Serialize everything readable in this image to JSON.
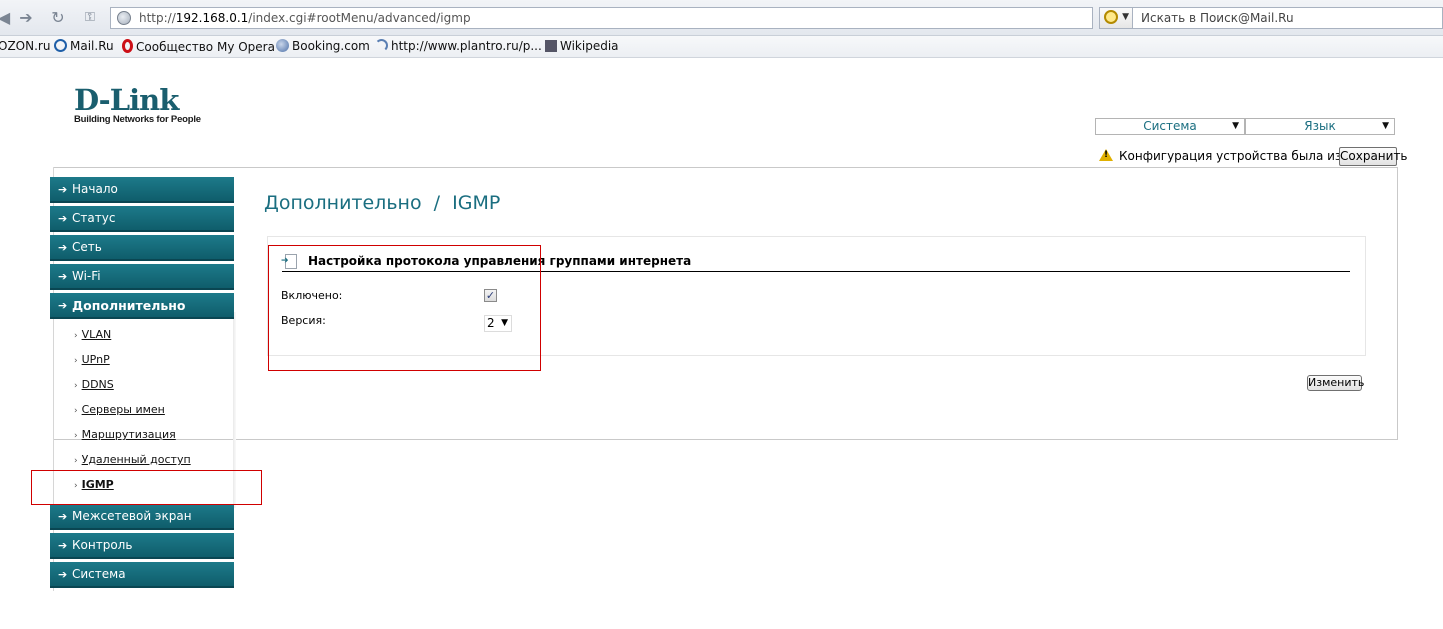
{
  "browser": {
    "url_prefix": "http://",
    "url_host": "192.168.0.1",
    "url_path": "/index.cgi#rootMenu/advanced/igmp",
    "search_placeholder": "Искать в Поиск@Mail.Ru"
  },
  "bookmarks": [
    {
      "label": "OZON.ru",
      "icon": "none"
    },
    {
      "label": "Mail.Ru",
      "icon": "at-icon"
    },
    {
      "label": "Сообщество My Opera",
      "icon": "opera-icon"
    },
    {
      "label": "Booking.com",
      "icon": "globe-icon"
    },
    {
      "label": "http://www.plantro.ru/p...",
      "icon": "rss-icon"
    },
    {
      "label": "Wikipedia",
      "icon": "wikipedia-icon"
    }
  ],
  "header": {
    "logo_main": "D-Link",
    "logo_tagline": "Building Networks for People",
    "system_select": "Система",
    "language_select": "Язык",
    "config_notice": "Конфигурация устройства была изменена",
    "save_label": "Сохранить"
  },
  "sidebar": {
    "items": [
      {
        "label": "Начало"
      },
      {
        "label": "Статус"
      },
      {
        "label": "Сеть"
      },
      {
        "label": "Wi-Fi"
      },
      {
        "label": "Дополнительно"
      },
      {
        "label": "Межсетевой экран"
      },
      {
        "label": "Контроль"
      },
      {
        "label": "Система"
      }
    ],
    "subitems": [
      {
        "label": "VLAN"
      },
      {
        "label": "UPnP"
      },
      {
        "label": "DDNS"
      },
      {
        "label": "Серверы имен"
      },
      {
        "label": "Маршрутизация"
      },
      {
        "label": "Удаленный доступ"
      },
      {
        "label": "IGMP"
      }
    ]
  },
  "main": {
    "title": "Дополнительно  /  IGMP",
    "section_title": "Настройка протокола управления группами интернета",
    "enabled_label": "Включено:",
    "enabled_checked": true,
    "version_label": "Версия:",
    "version_value": "2",
    "apply_label": "Изменить"
  },
  "colors": {
    "brand_teal": "#1a6e80",
    "menu_bg": "#1d7a8a",
    "annotation_red": "#d00000"
  }
}
